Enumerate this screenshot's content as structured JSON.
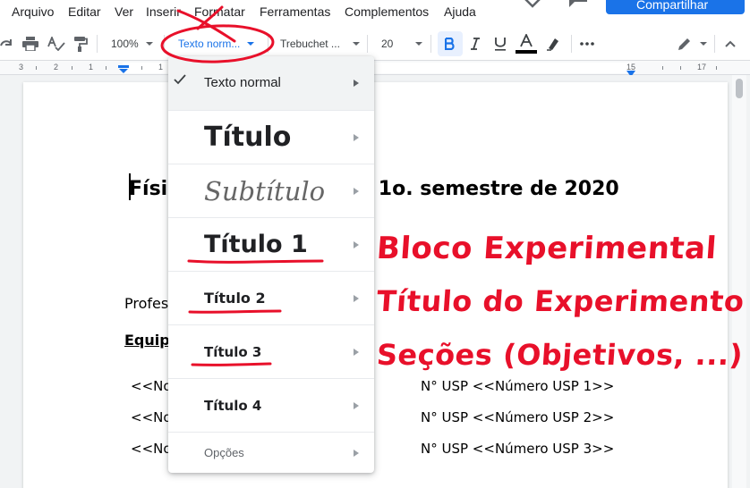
{
  "menu": [
    "Arquivo",
    "Editar",
    "Ver",
    "Inserir",
    "Formatar",
    "Ferramentas",
    "Complementos",
    "Ajuda"
  ],
  "header": {
    "share_label": "Compartilhar"
  },
  "toolbar": {
    "zoom": "100%",
    "style": "Texto norm...",
    "font": "Trebuchet ...",
    "size": "20"
  },
  "ruler": {
    "numbers": [
      "3",
      "2",
      "1",
      "1",
      "15",
      "17"
    ]
  },
  "document": {
    "title_left": "Físi",
    "title_right": "- 1o. semestre de 2020",
    "professor": "Profes",
    "equipe": "Equip",
    "rows": [
      {
        "left": "<<No",
        "right": "N° USP <<Número USP 1>>"
      },
      {
        "left": "<<No",
        "right": "N° USP <<Número USP 2>>"
      },
      {
        "left": "<<No",
        "right": "N° USP <<Número USP 3>>"
      }
    ]
  },
  "style_menu": {
    "items": [
      {
        "label": "Texto normal",
        "checked": true
      },
      {
        "label": "Título"
      },
      {
        "label": "Subtítulo"
      },
      {
        "label": "Título 1"
      },
      {
        "label": "Título 2"
      },
      {
        "label": "Título 3"
      },
      {
        "label": "Título 4"
      },
      {
        "label": "Opções"
      }
    ]
  },
  "annotations": {
    "color": "#e8102a",
    "notes": [
      "Bloco Experimental",
      "Título do Experimento",
      "Seções (Objetivos, ...)"
    ]
  }
}
